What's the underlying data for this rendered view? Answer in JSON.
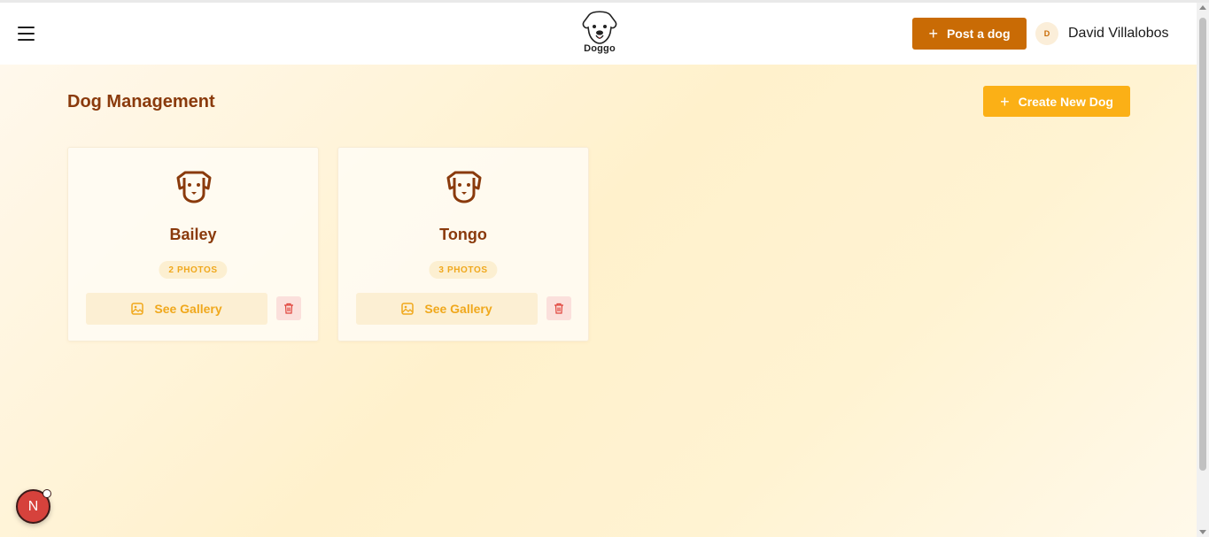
{
  "header": {
    "logo_text": "Doggo",
    "post_button_label": "Post a dog",
    "user": {
      "initial": "D",
      "name": "David Villalobos"
    }
  },
  "main": {
    "title": "Dog Management",
    "create_button_label": "Create New Dog",
    "dogs": [
      {
        "name": "Bailey",
        "photos_label": "2 PHOTOS",
        "gallery_label": "See Gallery"
      },
      {
        "name": "Tongo",
        "photos_label": "3 PHOTOS",
        "gallery_label": "See Gallery"
      }
    ]
  },
  "dev_badge": {
    "label": "N"
  },
  "colors": {
    "brand_primary": "#c96b05",
    "accent_yellow": "#fbb016",
    "title_brown": "#8a3a0c",
    "danger": "#e0453d"
  },
  "icons": [
    "menu-icon",
    "dog-logo-icon",
    "plus-icon",
    "dog-face-icon",
    "image-icon",
    "trash-icon"
  ]
}
